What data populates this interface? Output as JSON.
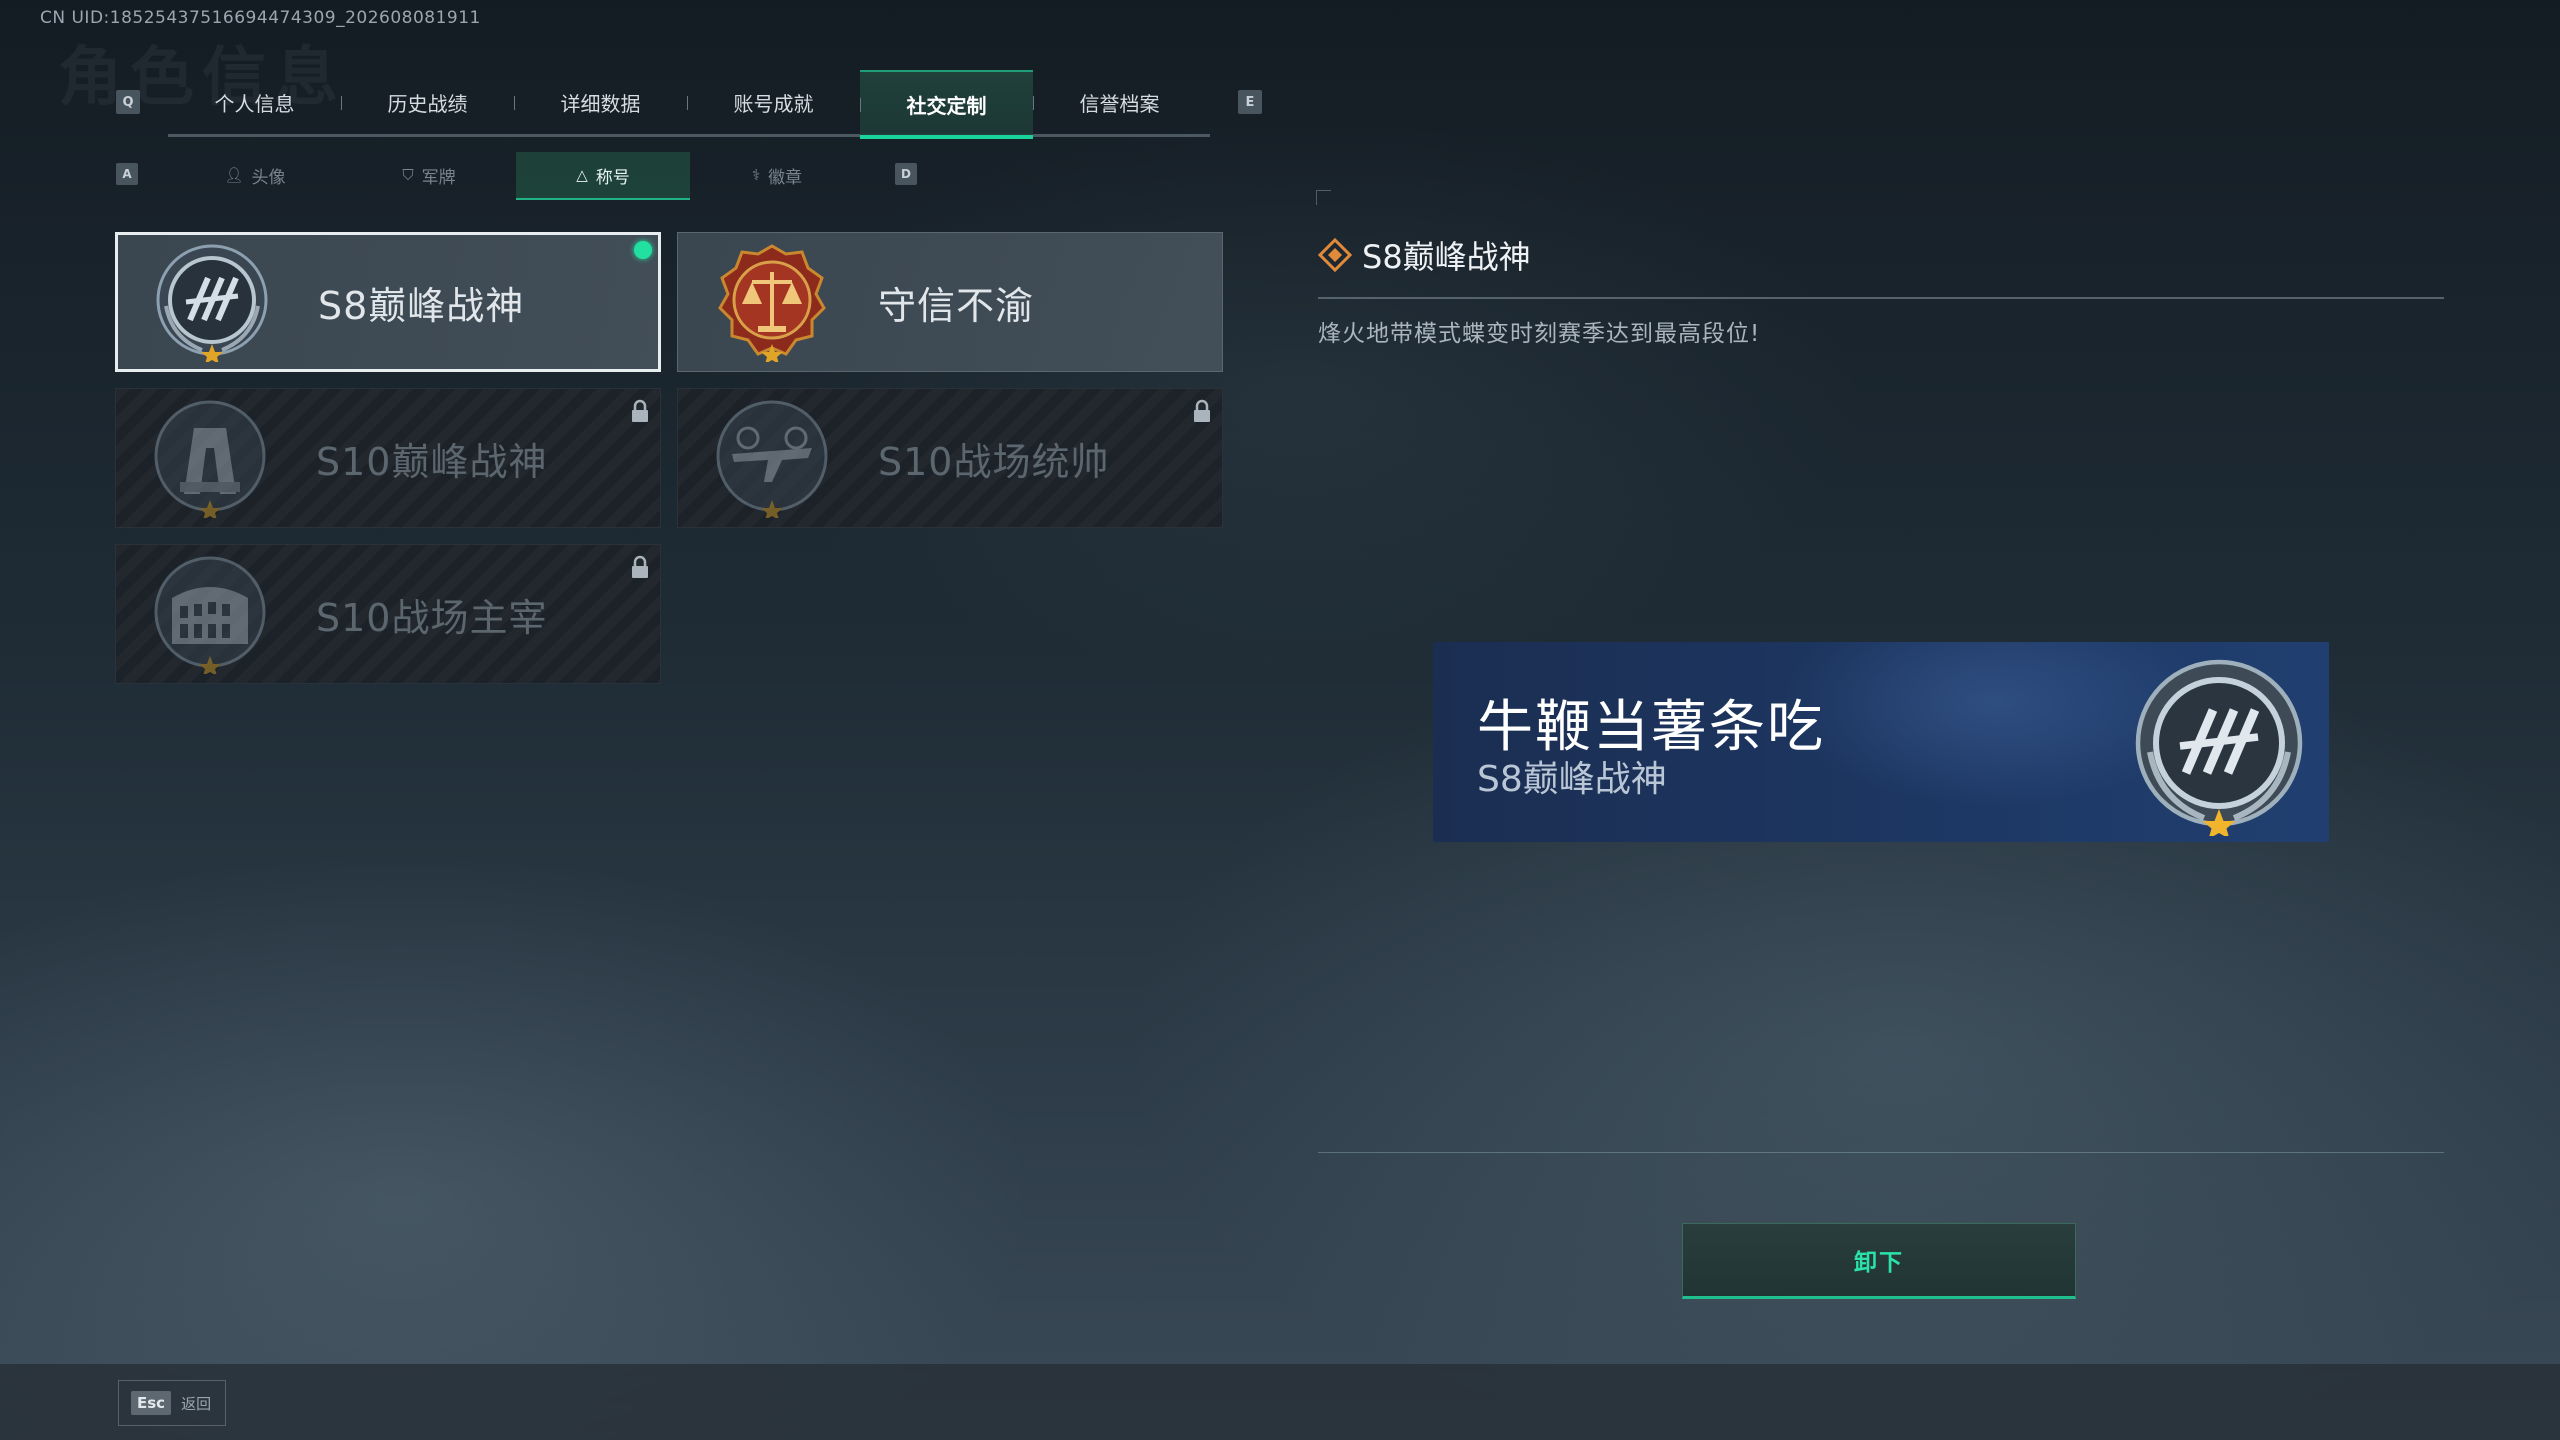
{
  "uid": "CN UID:18525437516694474309_202608081911",
  "ghost_title": "角色信息",
  "main_tabs": {
    "prev_key": "Q",
    "next_key": "E",
    "items": [
      {
        "label": "个人信息"
      },
      {
        "label": "历史战绩"
      },
      {
        "label": "详细数据"
      },
      {
        "label": "账号成就"
      },
      {
        "label": "社交定制"
      },
      {
        "label": "信誉档案"
      }
    ],
    "active_index": 4
  },
  "sub_tabs": {
    "prev_key": "A",
    "next_key": "D",
    "items": [
      {
        "label": "头像",
        "icon": "person-icon"
      },
      {
        "label": "军牌",
        "icon": "dogtag-icon"
      },
      {
        "label": "称号",
        "icon": "triangle-icon"
      },
      {
        "label": "徽章",
        "icon": "emblem-icon"
      }
    ],
    "active_index": 2
  },
  "titles": [
    {
      "name": "S8巅峰战神",
      "badge": "winged-h-emblem",
      "state": "equipped"
    },
    {
      "name": "守信不渝",
      "badge": "justice-scales-emblem",
      "state": "unlocked"
    },
    {
      "name": "S10巅峰战神",
      "badge": "arch-emblem",
      "state": "locked"
    },
    {
      "name": "S10战场统帅",
      "badge": "aircraft-emblem",
      "state": "locked"
    },
    {
      "name": "S10战场主宰",
      "badge": "colosseum-emblem",
      "state": "locked"
    }
  ],
  "detail": {
    "title": "S8巅峰战神",
    "description": "烽火地带模式蝶变时刻赛季达到最高段位!"
  },
  "preview": {
    "player_name": "牛鞭当薯条吃",
    "title": "S8巅峰战神"
  },
  "unequip_label": "卸下",
  "esc": {
    "key": "Esc",
    "label": "返回"
  },
  "colors": {
    "accent_green": "#1fd39a",
    "preview_blue": "#1d3763",
    "badge_gold": "#e0a526"
  }
}
